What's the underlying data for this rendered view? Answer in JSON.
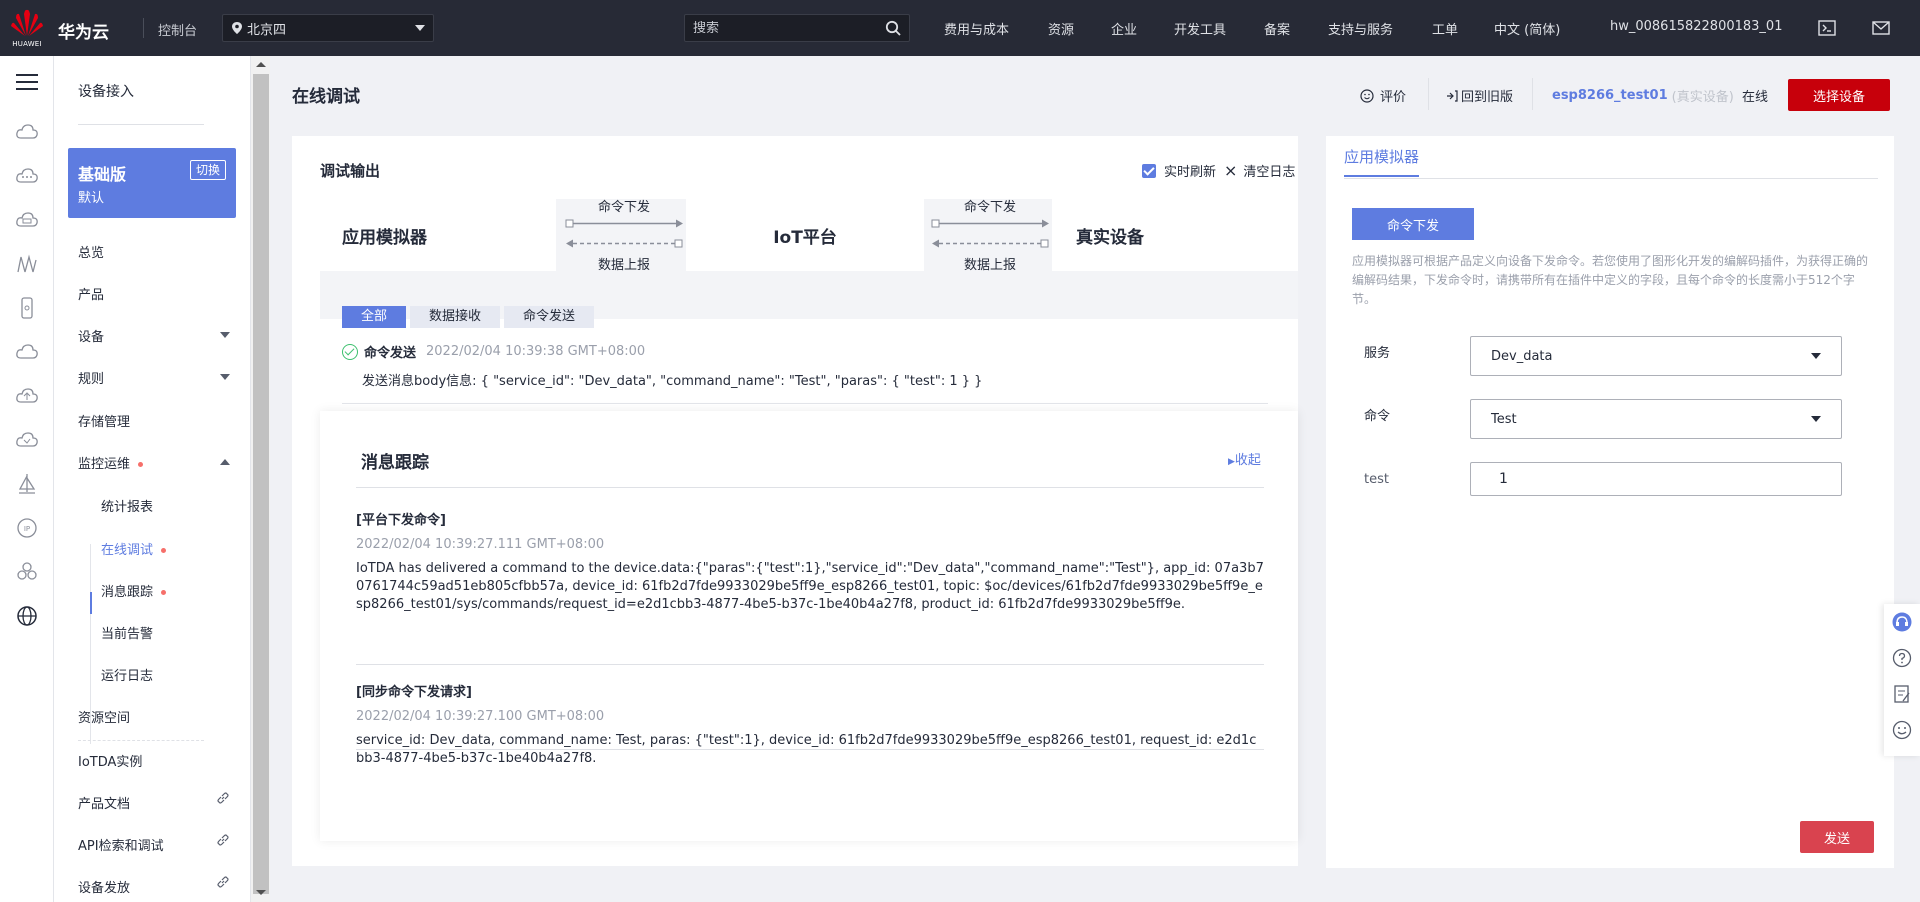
{
  "topbar": {
    "logo_caption": "HUAWEI",
    "brand": "华为云",
    "console": "控制台",
    "region": "北京四",
    "search_placeholder": "搜索",
    "nav": [
      "费用与成本",
      "资源",
      "企业",
      "开发工具",
      "备案",
      "支持与服务",
      "工单",
      "中文 (简体)",
      "hw_008615822800183_01"
    ]
  },
  "menu": {
    "title": "设备接入",
    "edition": {
      "name": "基础版",
      "desc": "默认",
      "switch": "切换"
    },
    "items": {
      "overview": "总览",
      "product": "产品",
      "device": "设备",
      "rules": "规则",
      "storage": "存储管理",
      "monitor": "监控运维",
      "stats": "统计报表",
      "online_debug": "在线调试",
      "msg_trace": "消息跟踪",
      "alarms": "当前告警",
      "run_log": "运行日志",
      "resource_space": "资源空间",
      "iotda_instance": "IoTDA实例",
      "product_docs": "产品文档",
      "api_explorer": "API检索和调试",
      "device_provision": "设备发放"
    }
  },
  "header": {
    "title": "在线调试",
    "rate": "评价",
    "back_old": "回到旧版",
    "device_name": "esp8266_test01",
    "device_type": "(真实设备)",
    "status": "在线",
    "select_device": "选择设备"
  },
  "debug": {
    "title": "调试输出",
    "realtime_refresh": "实时刷新",
    "clear_log": "清空日志",
    "nodes": [
      "应用模拟器",
      "IoT平台",
      "真实设备"
    ],
    "cmd_down": "命令下发",
    "data_up": "数据上报",
    "tabs": [
      "全部",
      "数据接收",
      "命令发送"
    ],
    "log": {
      "type": "命令发送",
      "time": "2022/02/04 10:39:38 GMT+08:00",
      "body": "发送消息body信息: { \"service_id\": \"Dev_data\", \"command_name\": \"Test\", \"paras\": { \"test\": 1 } }"
    }
  },
  "trace": {
    "title": "消息跟踪",
    "collapse": "收起",
    "entries": [
      {
        "title": "[平台下发命令]",
        "time": "2022/02/04 10:39:27.111 GMT+08:00",
        "body": "IoTDA has delivered a command to the device.data:{\"paras\":{\"test\":1},\"service_id\":\"Dev_data\",\"command_name\":\"Test\"}, app_id: 07a3b70761744c59ad51eb805cfbb57a, device_id: 61fb2d7fde9933029be5ff9e_esp8266_test01, topic: $oc/devices/61fb2d7fde9933029be5ff9e_esp8266_test01/sys/commands/request_id=e2d1cbb3-4877-4be5-b37c-1be40b4a27f8, product_id: 61fb2d7fde9933029be5ff9e."
      },
      {
        "title": "[同步命令下发请求]",
        "time": "2022/02/04 10:39:27.100 GMT+08:00",
        "body": "service_id: Dev_data, command_name: Test, paras: {\"test\":1}, device_id: 61fb2d7fde9933029be5ff9e_esp8266_test01, request_id: e2d1cbb3-4877-4be5-b37c-1be40b4a27f8."
      }
    ]
  },
  "simulator": {
    "tab": "应用模拟器",
    "cmd_button": "命令下发",
    "desc": "应用模拟器可根据产品定义向设备下发命令。若您使用了图形化开发的编解码插件，为获得正确的编解码结果，下发命令时，请携带所有在插件中定义的字段，且每个命令的长度需小于512个字节。",
    "service_label": "服务",
    "service_value": "Dev_data",
    "command_label": "命令",
    "command_value": "Test",
    "param_label": "test",
    "param_value": "1",
    "send": "发送"
  },
  "colors": {
    "brand_red": "#c7000b",
    "accent": "#5e7ce0",
    "topbar": "#272a36"
  }
}
